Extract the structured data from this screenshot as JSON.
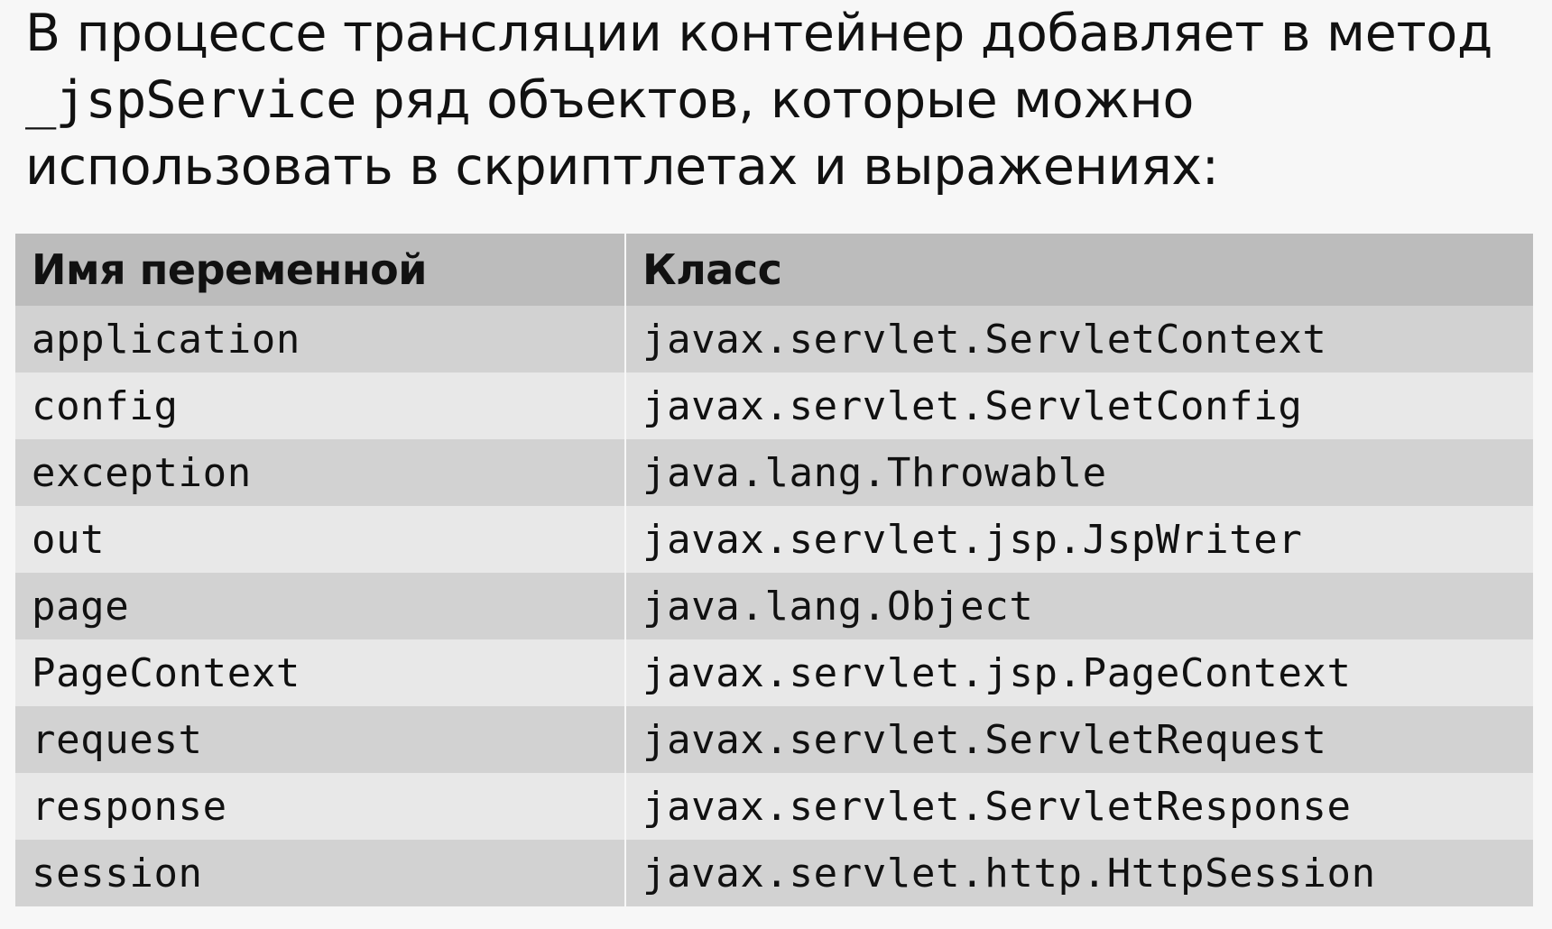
{
  "intro": {
    "part1": "В процессе трансляции контейнер добавляет в метод ",
    "code": "_jspService",
    "part2": " ряд объектов, которые можно использовать в скриптлетах и выражениях:"
  },
  "table": {
    "headers": [
      "Имя переменной",
      "Класс"
    ],
    "rows": [
      [
        "application",
        "javax.servlet.ServletContext"
      ],
      [
        "config",
        "javax.servlet.ServletConfig"
      ],
      [
        "exception",
        "java.lang.Throwable"
      ],
      [
        "out",
        "javax.servlet.jsp.JspWriter"
      ],
      [
        "page",
        "java.lang.Object"
      ],
      [
        "PageContext",
        "javax.servlet.jsp.PageContext"
      ],
      [
        "request",
        "javax.servlet.ServletRequest"
      ],
      [
        "response",
        "javax.servlet.ServletResponse"
      ],
      [
        "session",
        "javax.servlet.http.HttpSession"
      ]
    ]
  }
}
